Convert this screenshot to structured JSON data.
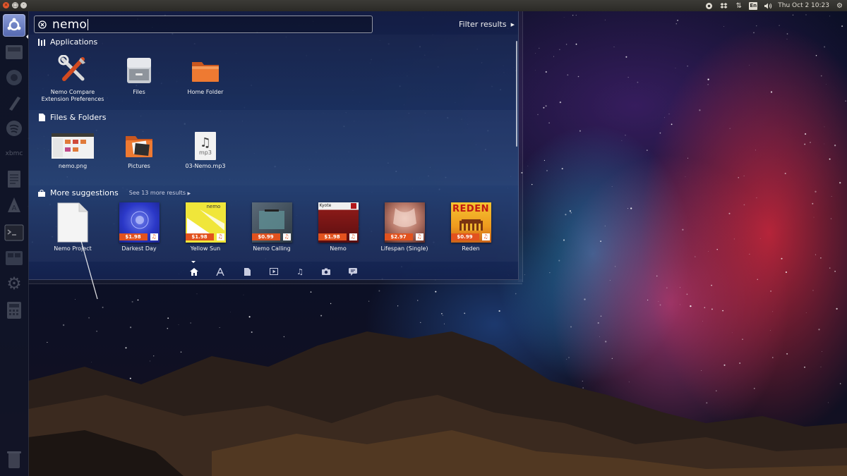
{
  "top_panel": {
    "clock": "Thu Oct  2 10:23",
    "keyboard_layout": "En",
    "icons": [
      "gear-circle-icon",
      "dropbox-icon",
      "network-arrows-icon",
      "keyboard-layout-icon",
      "volume-icon",
      "settings-gear-icon"
    ]
  },
  "launcher": {
    "items": [
      "ubuntu-dash-icon",
      "files-icon",
      "browser-icon",
      "text-editor-icon",
      "spotify-icon",
      "xbmc-icon",
      "document-icon",
      "software-center-icon",
      "terminal-icon",
      "workspace-icon",
      "system-settings-icon",
      "calculator-icon",
      "trash-icon"
    ]
  },
  "dash": {
    "search": {
      "value": "nemo"
    },
    "filter_label": "Filter results",
    "sections": {
      "applications": {
        "title": "Applications",
        "items": [
          {
            "label": "Nemo Compare Extension Preferences",
            "icon": "tools-icon"
          },
          {
            "label": "Files",
            "icon": "file-cabinet-icon"
          },
          {
            "label": "Home Folder",
            "icon": "home-folder-icon"
          }
        ]
      },
      "files": {
        "title": "Files & Folders",
        "items": [
          {
            "label": "nemo.png",
            "icon": "image-thumbnail-icon"
          },
          {
            "label": "Pictures",
            "icon": "pictures-folder-icon"
          },
          {
            "label": "03-Nemo.mp3",
            "icon": "mp3-file-icon",
            "badge": "mp3"
          }
        ]
      },
      "suggestions": {
        "title": "More suggestions",
        "see_more": "See 13 more results",
        "items": [
          {
            "label": "Nemo Project",
            "price": ""
          },
          {
            "label": "Darkest Day",
            "price": "$1.98"
          },
          {
            "label": "Yellow Sun",
            "price": "$1.98",
            "art_text": "nemo"
          },
          {
            "label": "Nemo Calling",
            "price": "$0.99"
          },
          {
            "label": "Nemo",
            "price": "$1.98",
            "art_text": "Kyote"
          },
          {
            "label": "Lifespan (Single)",
            "price": "$2.97"
          },
          {
            "label": "Reden",
            "price": "$0.99",
            "art_text": "REDEN"
          }
        ]
      }
    },
    "lenses": [
      "home-icon",
      "applications-icon",
      "files-icon",
      "video-icon",
      "music-icon",
      "photo-icon",
      "social-icon"
    ],
    "active_lens": "home-icon"
  },
  "colors": {
    "panel": "#3c3b37",
    "price_tag": "#e2521e",
    "close_button": "#e3572c"
  }
}
